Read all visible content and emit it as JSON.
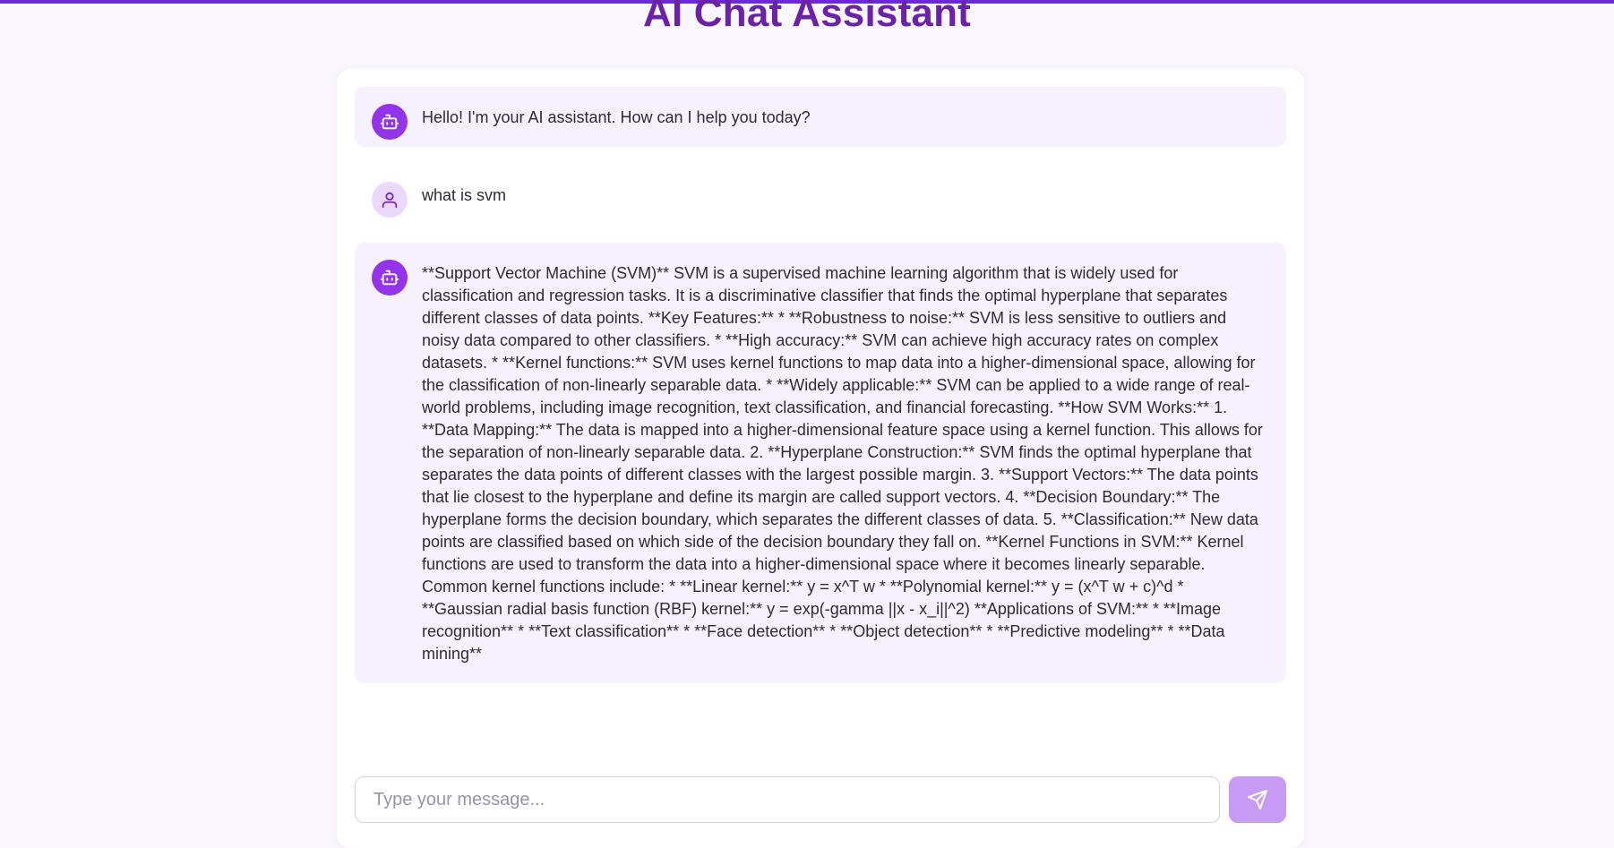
{
  "app": {
    "title": "AI Chat Assistant",
    "accent_color": "#6d28d9",
    "title_color": "#6b21a8"
  },
  "messages": [
    {
      "role": "assistant",
      "avatar_icon": "bot-icon",
      "text": "Hello! I'm your AI assistant. How can I help you today?"
    },
    {
      "role": "user",
      "avatar_icon": "user-icon",
      "text": "what is svm"
    },
    {
      "role": "assistant",
      "avatar_icon": "bot-icon",
      "text": "**Support Vector Machine (SVM)** SVM is a supervised machine learning algorithm that is widely used for classification and regression tasks. It is a discriminative classifier that finds the optimal hyperplane that separates different classes of data points. **Key Features:** * **Robustness to noise:** SVM is less sensitive to outliers and noisy data compared to other classifiers. * **High accuracy:** SVM can achieve high accuracy rates on complex datasets. * **Kernel functions:** SVM uses kernel functions to map data into a higher-dimensional space, allowing for the classification of non-linearly separable data. * **Widely applicable:** SVM can be applied to a wide range of real-world problems, including image recognition, text classification, and financial forecasting. **How SVM Works:** 1. **Data Mapping:** The data is mapped into a higher-dimensional feature space using a kernel function. This allows for the separation of non-linearly separable data. 2. **Hyperplane Construction:** SVM finds the optimal hyperplane that separates the data points of different classes with the largest possible margin. 3. **Support Vectors:** The data points that lie closest to the hyperplane and define its margin are called support vectors. 4. **Decision Boundary:** The hyperplane forms the decision boundary, which separates the different classes of data. 5. **Classification:** New data points are classified based on which side of the decision boundary they fall on. **Kernel Functions in SVM:** Kernel functions are used to transform the data into a higher-dimensional space where it becomes linearly separable. Common kernel functions include: * **Linear kernel:** y = x^T w * **Polynomial kernel:** y = (x^T w + c)^d * **Gaussian radial basis function (RBF) kernel:** y = exp(-gamma ||x - x_i||^2) **Applications of SVM:** * **Image recognition** * **Text classification** * **Face detection** * **Object detection** * **Predictive modeling** * **Data mining**"
    }
  ],
  "composer": {
    "placeholder": "Type your message...",
    "value": "",
    "send_icon": "send-icon",
    "send_color": "#c79bf3"
  }
}
